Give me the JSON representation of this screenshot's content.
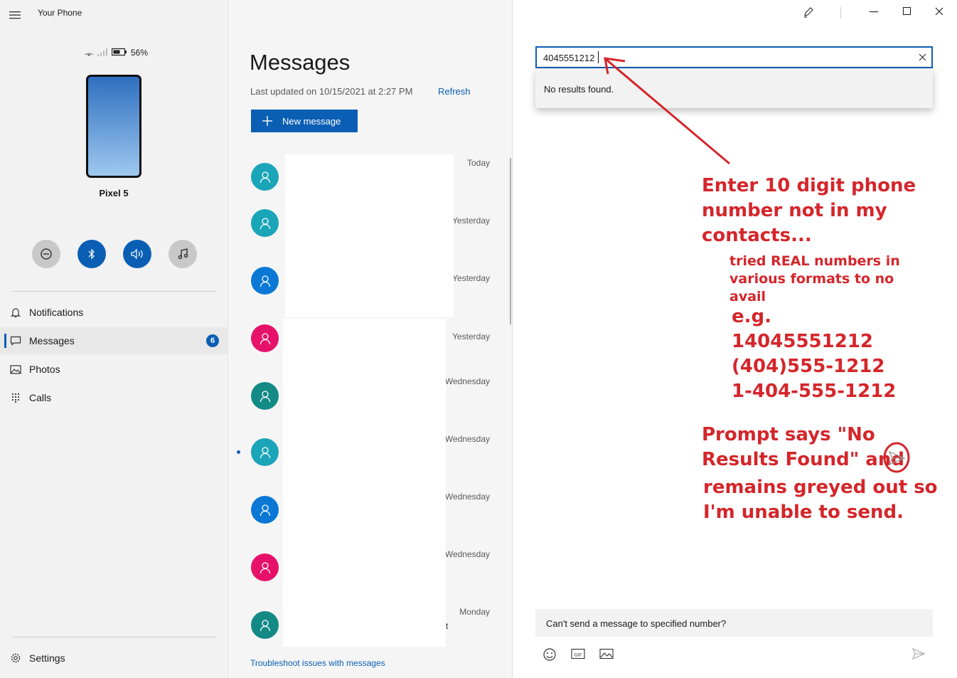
{
  "app": {
    "title": "Your Phone"
  },
  "phone": {
    "battery": "56%",
    "name": "Pixel 5"
  },
  "quick_actions": [
    {
      "icon": "do-not-disturb-icon",
      "color": "#c8c8c8"
    },
    {
      "icon": "bluetooth-icon",
      "color": "#0a5fb4"
    },
    {
      "icon": "volume-icon",
      "color": "#0a5fb4"
    },
    {
      "icon": "music-icon",
      "color": "#c8c8c8"
    }
  ],
  "nav": {
    "items": [
      {
        "label": "Notifications",
        "icon": "bell-icon"
      },
      {
        "label": "Messages",
        "icon": "message-icon",
        "badge": "6"
      },
      {
        "label": "Photos",
        "icon": "photos-icon"
      },
      {
        "label": "Calls",
        "icon": "dialpad-icon"
      }
    ],
    "settings": "Settings"
  },
  "messages": {
    "title": "Messages",
    "last_updated": "Last updated on 10/15/2021 at 2:27 PM",
    "refresh": "Refresh",
    "new_message": "New message",
    "troubleshoot": "Troubleshoot issues with messages",
    "conversations": [
      {
        "date": "Today",
        "color": "#1aa5b8"
      },
      {
        "date": "Yesterday",
        "color": "#1aa5b8"
      },
      {
        "date": "Yesterday",
        "color": "#0a78d4"
      },
      {
        "date": "Yesterday",
        "color": "#e6126a"
      },
      {
        "date": "Wednesday",
        "color": "#138a86"
      },
      {
        "date": "Wednesday",
        "color": "#1aa5b8",
        "unread": true
      },
      {
        "date": "Wednesday",
        "color": "#0a78d4"
      },
      {
        "date": "Wednesday",
        "color": "#e6126a"
      },
      {
        "date": "Monday",
        "color": "#138a86",
        "snippet_tail": "t"
      }
    ]
  },
  "compose": {
    "recipient_value": "4045551212",
    "no_results": "No results found.",
    "message_text": "Can't send a message to specified number?"
  },
  "annotations": {
    "line1": "Enter 10 digit phone",
    "line2": "number not in my",
    "line3": "contacts...",
    "small1": "tried REAL numbers in",
    "small2": "various formats to no",
    "small3": "avail",
    "eg": "e.g.",
    "f1": "14045551212",
    "f2": "(404)555-1212",
    "f3": "1-404-555-1212",
    "p1": "Prompt says \"No",
    "p2": "Results Found\" and",
    "p3": "remains greyed out so",
    "p4": "I'm unable to send.",
    "color": "#d4262b"
  }
}
